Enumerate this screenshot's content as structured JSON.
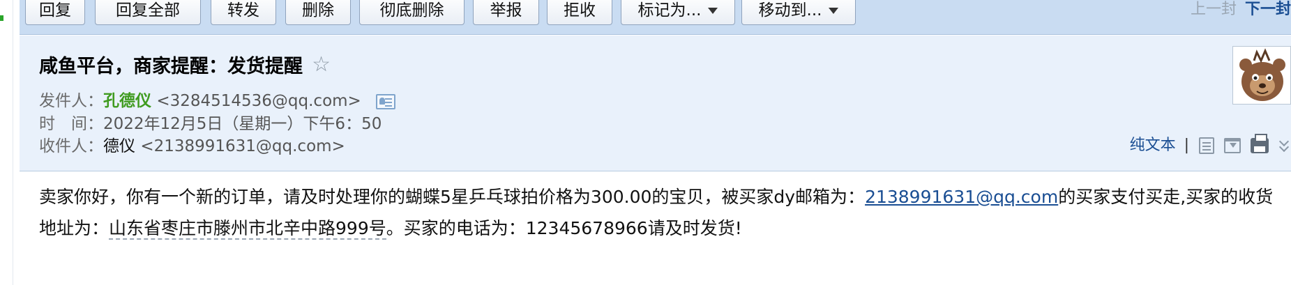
{
  "toolbar": {
    "buttons": [
      {
        "label": "回复"
      },
      {
        "label": "回复全部"
      },
      {
        "label": "转发"
      },
      {
        "label": "删除"
      },
      {
        "label": "彻底删除"
      },
      {
        "label": "举报"
      },
      {
        "label": "拒收"
      },
      {
        "label": "标记为..."
      },
      {
        "label": "移动到..."
      }
    ],
    "prev_label": "上一封",
    "next_label": "下一封"
  },
  "header": {
    "subject": "咸鱼平台，商家提醒：发货提醒",
    "star_glyph": "☆",
    "from_label": "发件人：",
    "from_name": "孔德仪",
    "from_address": "<3284514536@qq.com>",
    "time_label": "时　间：",
    "time_value": "2022年12月5日（星期一）下午6：50",
    "to_label": "收件人：",
    "to_name": "德仪",
    "to_address": "<2138991631@qq.com>",
    "plain_text_link": "纯文本",
    "separator": "|"
  },
  "body": {
    "part1": "卖家你好，你有一个新的订单，请及时处理你的蝴蝶5星乒乓球拍价格为300.00的宝贝，被买家dy邮箱为：",
    "buyer_email": "2138991631@qq.com",
    "part2": "的买家支付买走,买家的收货地址为：",
    "address": "山东省枣庄市滕州市北辛中路999号",
    "part3": "。买家的电话为：12345678966请及时发货!"
  },
  "colors": {
    "toolbar_bg": "#c9dcf2",
    "header_bg": "#e9f1fb",
    "sender_green": "#3f9b1f",
    "link_blue": "#1a4e93"
  },
  "icons": {
    "contact_card": "contact-card-icon",
    "note": "note-icon",
    "save": "save-icon",
    "print": "print-icon",
    "more": "expand-more-icon"
  }
}
